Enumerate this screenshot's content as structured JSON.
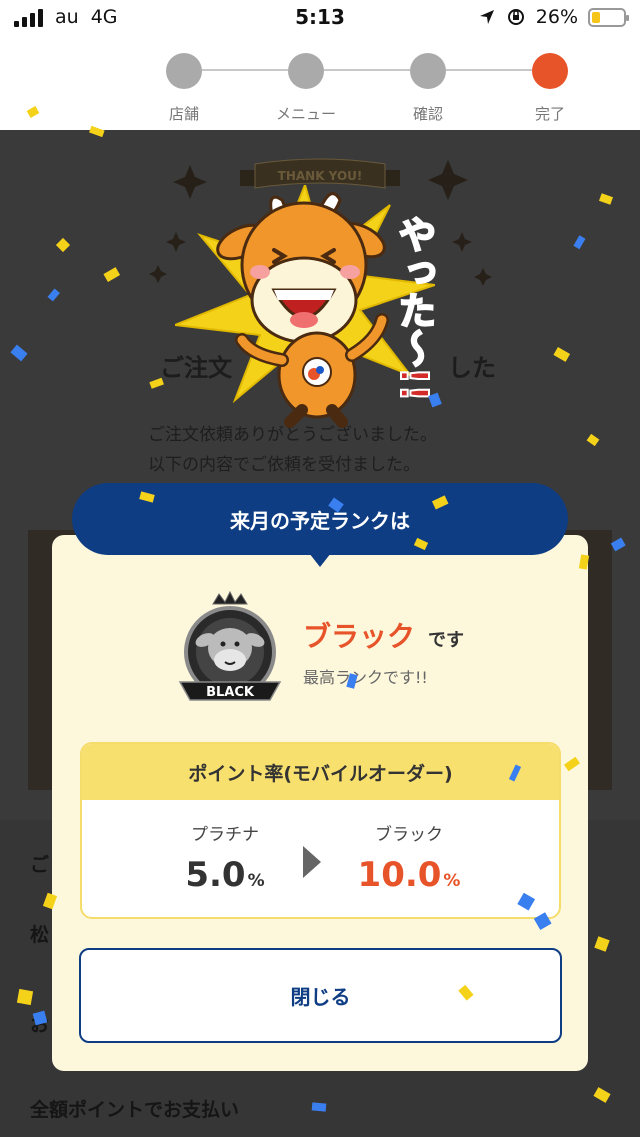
{
  "status_bar": {
    "carrier": "au",
    "network": "4G",
    "time": "5:13",
    "battery": "26%",
    "battery_level": 0.26
  },
  "steps": {
    "items": [
      {
        "label": "店舗",
        "active": false
      },
      {
        "label": "メニュー",
        "active": false
      },
      {
        "label": "確認",
        "active": false
      },
      {
        "label": "完了",
        "active": true
      }
    ],
    "active_color": "#e8542a",
    "inactive_color": "#aaaaaa"
  },
  "background_page": {
    "title_fragment_left": "ご注文",
    "title_fragment_right": "した",
    "message_line1": "ご注文依頼ありがとうございました。",
    "message_line2": "以下の内容でご依頼を受付ました。",
    "row_fragment_1": "ご",
    "row_fragment_2": "松",
    "row_fragment_3": "お",
    "row_payment": "全額ポイントでお支払い"
  },
  "celebration": {
    "ribbon_text": "THANK YOU!",
    "exclaim_text": "やった〜!!"
  },
  "modal": {
    "header": "来月の予定ランクは",
    "badge_text": "BLACK",
    "rank_name": "ブラック",
    "rank_suffix": "です",
    "rank_note": "最高ランクです!!",
    "rate_title": "ポイント率(モバイルオーダー)",
    "current_rank": "プラチナ",
    "current_rate": "5.0",
    "next_rank": "ブラック",
    "next_rate": "10.0",
    "percent_unit": "%",
    "close_label": "閉じる",
    "colors": {
      "navy": "#0e3d84",
      "orange": "#e8542a",
      "cream": "#fdf8dc",
      "yellow": "#f8e06e"
    }
  }
}
